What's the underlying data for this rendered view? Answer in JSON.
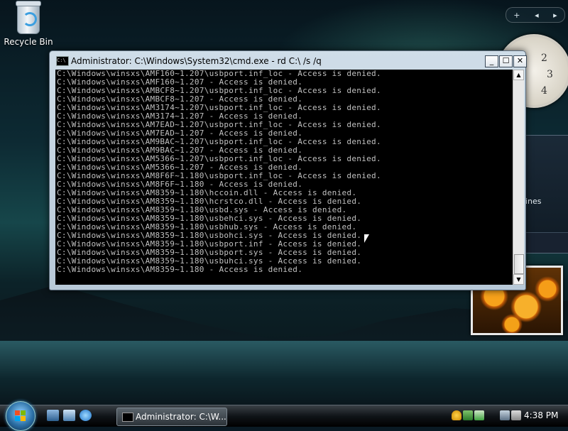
{
  "desktop": {
    "recycle_bin_label": "Recycle Bin",
    "gadget_text": "ines",
    "clock_numbers": [
      "2",
      "3",
      "4"
    ]
  },
  "sidebar": {
    "add_label": "+",
    "prev_label": "◂",
    "next_label": "▸"
  },
  "cmd": {
    "title": "Administrator: C:\\Windows\\System32\\cmd.exe - rd  C:\\ /s /q",
    "icon_text": "C:\\",
    "minimize_label": "_",
    "maximize_label": "☐",
    "close_label": "✕",
    "lines": [
      "C:\\Windows\\winsxs\\AMF160~1.207\\usbport.inf_loc - Access is denied.",
      "C:\\Windows\\winsxs\\AMF160~1.207 - Access is denied.",
      "C:\\Windows\\winsxs\\AMBCF8~1.207\\usbport.inf_loc - Access is denied.",
      "C:\\Windows\\winsxs\\AMBCF8~1.207 - Access is denied.",
      "C:\\Windows\\winsxs\\AM3174~1.207\\usbport.inf_loc - Access is denied.",
      "C:\\Windows\\winsxs\\AM3174~1.207 - Access is denied.",
      "C:\\Windows\\winsxs\\AM7EAD~1.207\\usbport.inf_loc - Access is denied.",
      "C:\\Windows\\winsxs\\AM7EAD~1.207 - Access is denied.",
      "C:\\Windows\\winsxs\\AM9BAC~1.207\\usbport.inf_loc - Access is denied.",
      "C:\\Windows\\winsxs\\AM9BAC~1.207 - Access is denied.",
      "C:\\Windows\\winsxs\\AM5366~1.207\\usbport.inf_loc - Access is denied.",
      "C:\\Windows\\winsxs\\AM5366~1.207 - Access is denied.",
      "C:\\Windows\\winsxs\\AM8F6F~1.180\\usbport.inf_loc - Access is denied.",
      "C:\\Windows\\winsxs\\AM8F6F~1.180 - Access is denied.",
      "C:\\Windows\\winsxs\\AM8359~1.180\\hccoin.dll - Access is denied.",
      "C:\\Windows\\winsxs\\AM8359~1.180\\hcrstco.dll - Access is denied.",
      "C:\\Windows\\winsxs\\AM8359~1.180\\usbd.sys - Access is denied.",
      "C:\\Windows\\winsxs\\AM8359~1.180\\usbehci.sys - Access is denied.",
      "C:\\Windows\\winsxs\\AM8359~1.180\\usbhub.sys - Access is denied.",
      "C:\\Windows\\winsxs\\AM8359~1.180\\usbohci.sys - Access is denied.",
      "C:\\Windows\\winsxs\\AM8359~1.180\\usbport.inf - Access is denied.",
      "C:\\Windows\\winsxs\\AM8359~1.180\\usbport.sys - Access is denied.",
      "C:\\Windows\\winsxs\\AM8359~1.180\\usbuhci.sys - Access is denied.",
      "C:\\Windows\\winsxs\\AM8359~1.180 - Access is denied."
    ]
  },
  "taskbar": {
    "task_label": "Administrator: C:\\W...",
    "time": "4:38 PM"
  }
}
